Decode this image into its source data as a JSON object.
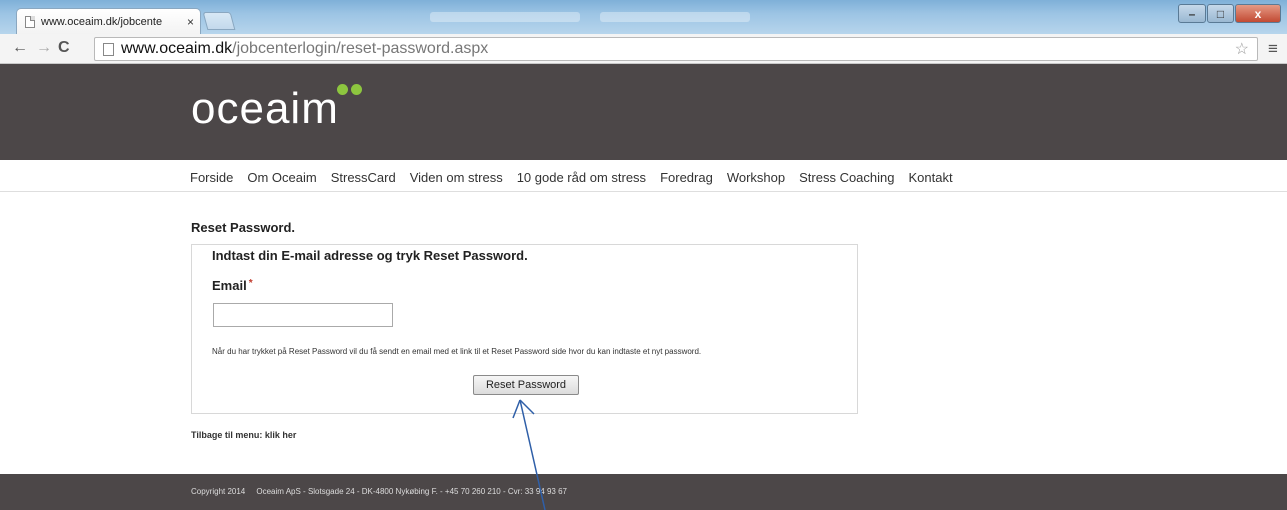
{
  "browser": {
    "tab_title": "www.oceaim.dk/jobcente",
    "tab_close": "×",
    "url_host": "www.oceaim.dk",
    "url_path": "/jobcenterlogin/reset-password.aspx",
    "win_min": "–",
    "win_max": "□",
    "win_close": "x"
  },
  "site": {
    "logo": "oceaim",
    "nav": [
      "Forside",
      "Om Oceaim",
      "StressCard",
      "Viden om stress",
      "10 gode råd om stress",
      "Foredrag",
      "Workshop",
      "Stress Coaching",
      "Kontakt"
    ]
  },
  "form": {
    "page_title": "Reset Password.",
    "heading": "Indtast din E-mail adresse og tryk Reset Password.",
    "email_label": "Email",
    "required_mark": "*",
    "email_value": "",
    "info": "Når du har trykket på Reset Password vil du få sendt en email med et link til et Reset Password side hvor du kan indtaste et nyt password.",
    "button_label": "Reset Password"
  },
  "back_link": "Tilbage til menu: klik her",
  "footer": {
    "text": "Copyright 2014     Oceaim ApS - Slotsgade 24 - DK-4800 Nykøbing F. - +45 70 260 210 - Cvr: 33 94 93 67"
  },
  "colors": {
    "header_bg": "#4c4748",
    "logo_dots": "#8dc63f",
    "annotation_arrow": "#2f5fa8"
  },
  "icons": [
    "page-icon",
    "back-arrow-icon",
    "forward-arrow-icon",
    "reload-icon",
    "star-icon",
    "menu-icon"
  ]
}
